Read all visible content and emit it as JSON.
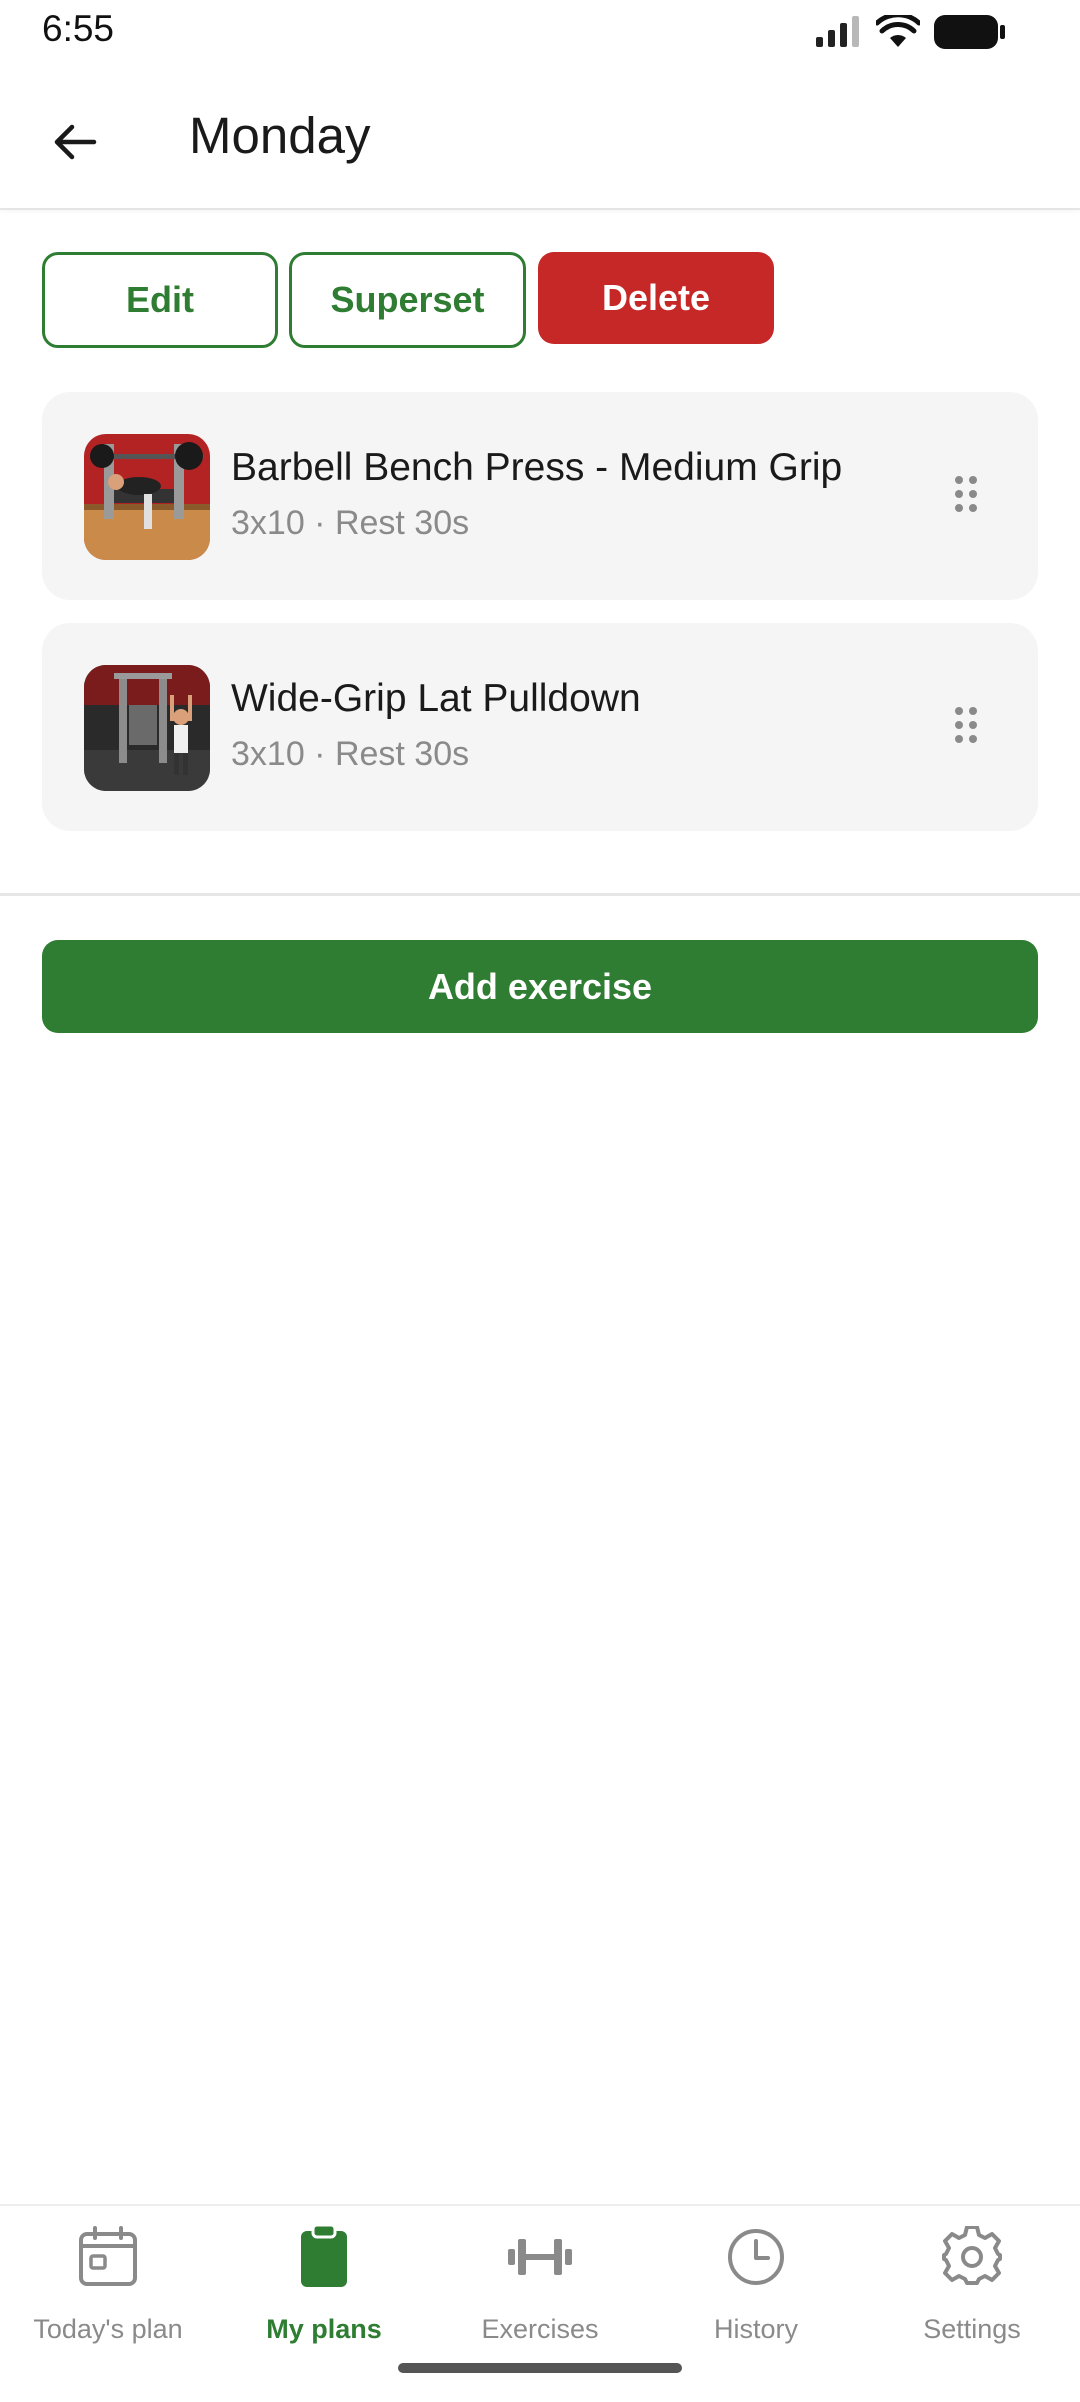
{
  "status_bar": {
    "time": "6:55",
    "icons": [
      "signal-icon",
      "wifi-icon",
      "battery-icon"
    ]
  },
  "header": {
    "title": "Monday",
    "back_icon": "arrow-left-icon"
  },
  "actions": {
    "edit_label": "Edit",
    "superset_label": "Superset",
    "delete_label": "Delete"
  },
  "exercises": [
    {
      "name": "Barbell Bench Press - Medium Grip",
      "meta": "3x10 · Rest 30s",
      "thumbnail": "bench-press-photo"
    },
    {
      "name": "Wide-Grip Lat Pulldown",
      "meta": "3x10 · Rest 30s",
      "thumbnail": "lat-pulldown-photo"
    }
  ],
  "add_button_label": "Add exercise",
  "bottom_nav": {
    "items": [
      {
        "label": "Today's plan",
        "icon": "calendar-icon",
        "active": false
      },
      {
        "label": "My plans",
        "icon": "clipboard-icon",
        "active": true
      },
      {
        "label": "Exercises",
        "icon": "dumbbell-icon",
        "active": false
      },
      {
        "label": "History",
        "icon": "clock-icon",
        "active": false
      },
      {
        "label": "Settings",
        "icon": "gear-icon",
        "active": false
      }
    ]
  },
  "colors": {
    "primary": "#2e7d32",
    "danger": "#c62828",
    "card_bg": "#f5f5f5",
    "muted_text": "#8a8a8a"
  }
}
